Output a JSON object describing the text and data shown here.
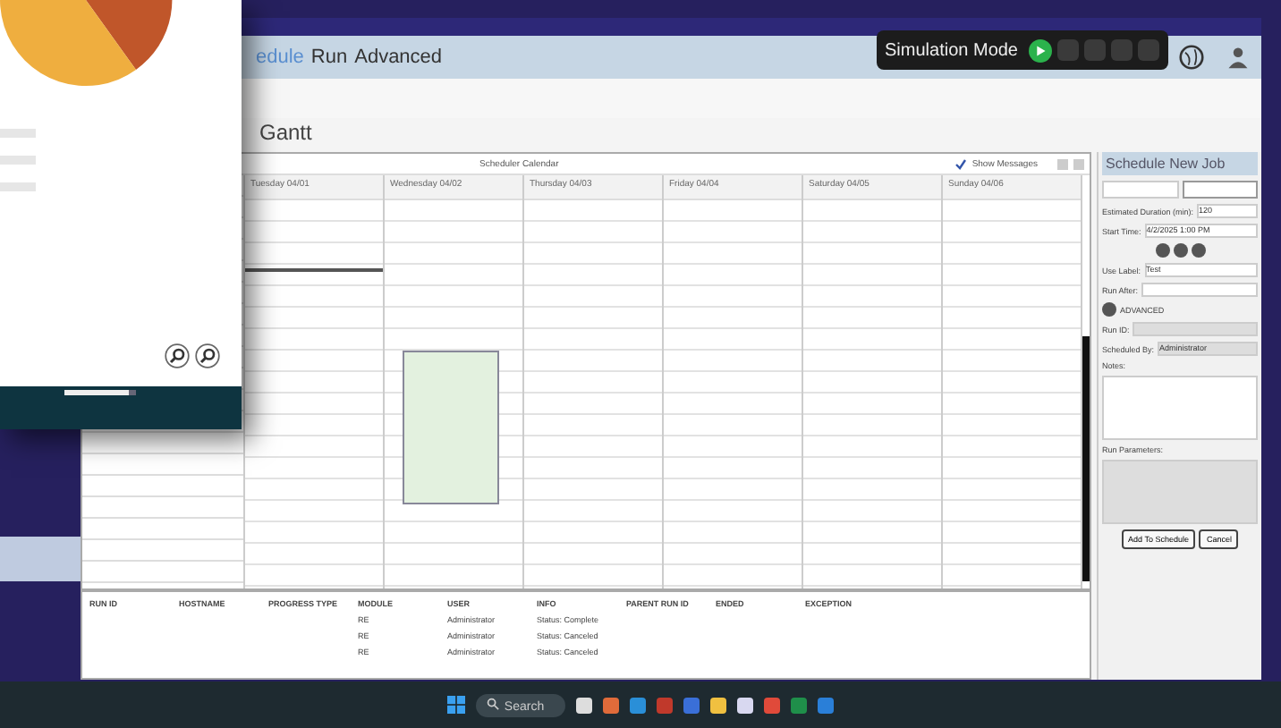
{
  "main_window": {
    "menu": [
      {
        "label": "edule",
        "selected": true
      },
      {
        "label": "Run",
        "selected": false
      },
      {
        "label": "Advanced",
        "selected": false
      }
    ],
    "simulation": {
      "label": "Simulation Mode",
      "running": true
    },
    "view_title": "Gantt",
    "calendar": {
      "title": "Scheduler Calendar",
      "show_messages": {
        "label": "Show Messages",
        "checked": true
      },
      "days": [
        {
          "label": "Tuesday 04/01",
          "bar": true,
          "job": false
        },
        {
          "label": "Wednesday 04/02",
          "bar": false,
          "job": true
        },
        {
          "label": "Thursday 04/03",
          "bar": false,
          "job": false
        },
        {
          "label": "Friday 04/04",
          "bar": false,
          "job": false
        },
        {
          "label": "Saturday 04/05",
          "bar": false,
          "job": false
        },
        {
          "label": "Sunday 04/06",
          "bar": false,
          "job": false
        }
      ]
    },
    "schedule_panel": {
      "title": "Schedule New Job",
      "duration_label": "Estimated Duration (min):",
      "duration": "120",
      "start_label": "Start Time:",
      "start": "4/2/2025 1:00 PM",
      "use_label": "Use Label:",
      "use_value": "Test",
      "run_after": "Run After:",
      "advanced": "ADVANCED",
      "run_id": "Run ID:",
      "scheduled_by": "Scheduled By:",
      "scheduled_by_value": "Administrator",
      "notes": "Notes:",
      "parameters": "Run Parameters:",
      "buttons": [
        "Add To Schedule",
        "Cancel"
      ]
    },
    "log_table": {
      "columns": [
        "RUN ID",
        "HOSTNAME",
        "PROGRESS TYPE",
        "MODULE",
        "USER",
        "INFO",
        "PARENT RUN ID",
        "ENDED",
        "EXCEPTION"
      ],
      "rows": [
        [
          "",
          "",
          "",
          "RE",
          "Administrator",
          "Status: Complete",
          "",
          "",
          ""
        ],
        [
          "",
          "",
          "",
          "RE",
          "Administrator",
          "Status: Canceled",
          "",
          "",
          ""
        ],
        [
          "",
          "",
          "",
          "RE",
          "Administrator",
          "Status: Canceled",
          "",
          "",
          ""
        ]
      ]
    }
  },
  "chart_window": {
    "slider": {
      "level": 0.9
    }
  },
  "taskbar": {
    "search": "Search"
  }
}
